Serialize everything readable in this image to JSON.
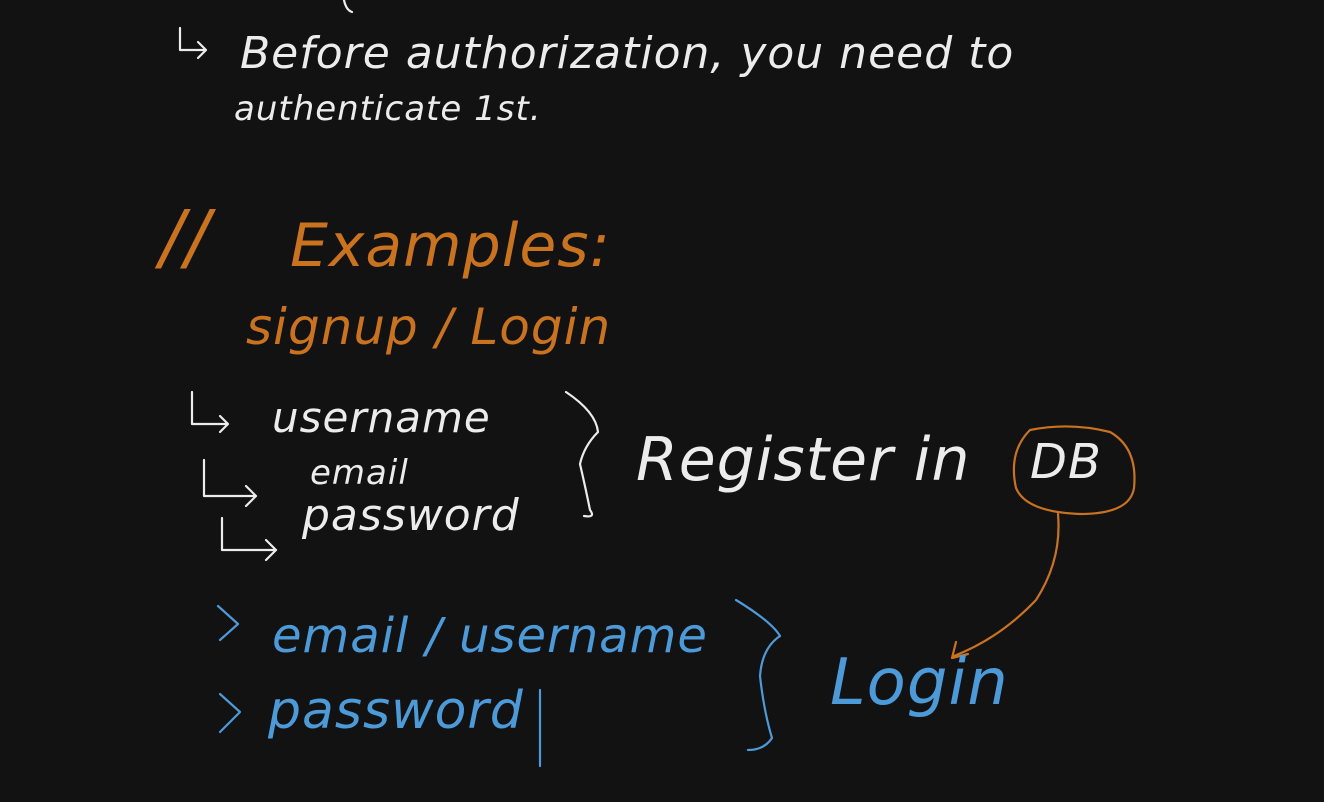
{
  "colors": {
    "background": "#121212",
    "white_ink": "#ececec",
    "orange_ink": "#c9731f",
    "blue_ink": "#4d9ad9"
  },
  "notes": {
    "line1": "Before authorization, you need to",
    "line2": "authenticate 1st.",
    "comment_marker": "//",
    "examples_heading": "Examples:",
    "signup_login": "signup / Login",
    "register_fields": [
      "username",
      "email",
      "password"
    ],
    "register_label": "Register in",
    "db_label": "DB",
    "login_fields": [
      "email / username",
      "password"
    ],
    "login_label": "Login"
  }
}
